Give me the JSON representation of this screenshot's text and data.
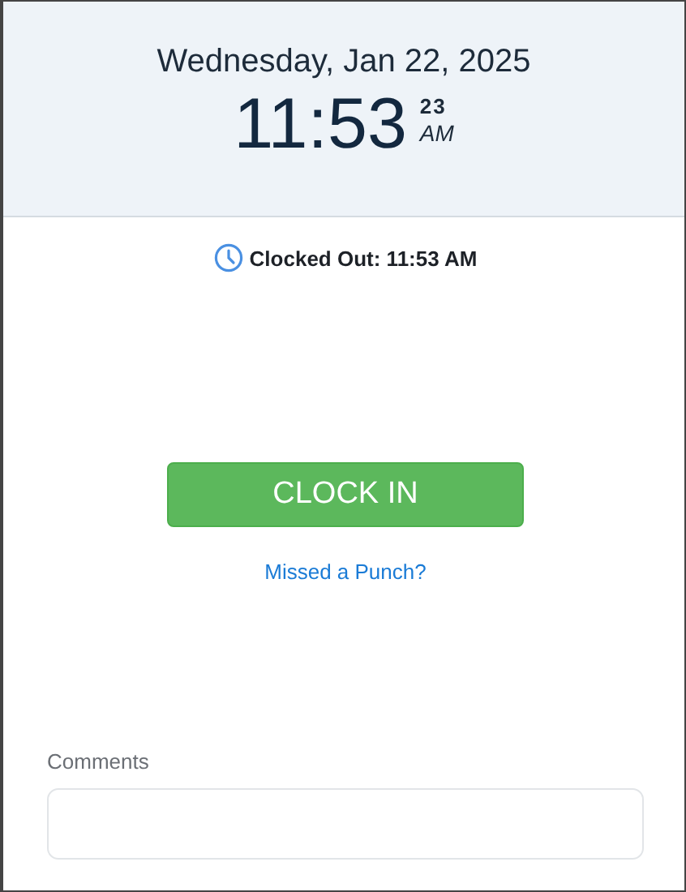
{
  "header": {
    "date": "Wednesday, Jan 22, 2025",
    "time": "11:53",
    "seconds": "23",
    "meridiem": "AM"
  },
  "status": {
    "text": "Clocked Out: 11:53 AM"
  },
  "clock_button": {
    "label": "CLOCK IN"
  },
  "missed_punch_link": {
    "label": "Missed a Punch?"
  },
  "comments": {
    "label": "Comments"
  }
}
